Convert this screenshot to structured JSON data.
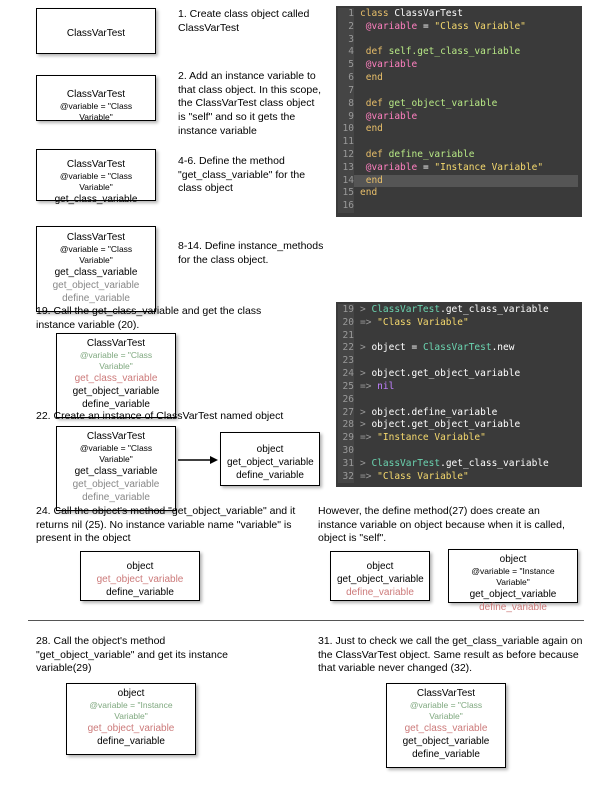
{
  "boxes": {
    "b1": {
      "line1": "ClassVarTest"
    },
    "b2": {
      "line1": "ClassVarTest",
      "line2": "@variable = \"Class Variable\""
    },
    "b3": {
      "line1": "ClassVarTest",
      "line2": "@variable = \"Class Variable\"",
      "line3": "get_class_variable"
    },
    "b4": {
      "line1": "ClassVarTest",
      "line2": "@variable = \"Class Variable\"",
      "line3": "get_class_variable",
      "line4": "get_object_variable",
      "line5": "define_variable"
    },
    "b5": {
      "line1": "ClassVarTest",
      "line2": "@variable = \"Class Variable\"",
      "line3": "get_class_variable",
      "line4": "get_object_variable",
      "line5": "define_variable"
    },
    "b6": {
      "line1": "ClassVarTest",
      "line2": "@variable = \"Class Variable\"",
      "line3": "get_class_variable",
      "line4": "get_object_variable",
      "line5": "define_variable"
    },
    "b6r": {
      "line1": "object",
      "line2": "get_object_variable",
      "line3": "define_variable"
    },
    "b7": {
      "line1": "object",
      "line2": "get_object_variable",
      "line3": "define_variable"
    },
    "b8": {
      "line1": "object",
      "line2": "get_object_variable",
      "line3": "define_variable"
    },
    "b8r": {
      "line1": "object",
      "line2": "@variable = \"Instance Variable\"",
      "line3": "get_object_variable",
      "line4": "define_variable"
    },
    "b9": {
      "line1": "object",
      "line2": "@variable = \"Instance Variable\"",
      "line3": "get_object_variable",
      "line4": "define_variable"
    },
    "b10": {
      "line1": "ClassVarTest",
      "line2": "@variable = \"Class Variable\"",
      "line3": "get_class_variable",
      "line4": "get_object_variable",
      "line5": "define_variable"
    }
  },
  "desc": {
    "d1": "1. Create class object called ClassVarTest",
    "d2": "2. Add an instance variable to that class object. In  this scope, the ClassVarTest class object is \"self\" and so it gets the instance variable",
    "d3": "4-6. Define the method \"get_class_variable\" for the class object",
    "d4": "8-14. Define instance_methods for the class object.",
    "d5": "19. Call the get_class_variable and get the class instance variable (20).",
    "d6": "22. Create an instance of ClassVarTest named object",
    "d7": "24. Call the object's method \"get_object_variable\" and it returns nil (25). No instance variable name \"variable\" is present in the object",
    "d7r": "However, the define method(27) does create an instance variable on object because when it is called, object is \"self\".",
    "d8": "28. Call the object's method \"get_object_variable\" and get its instance variable(29)",
    "d9": "31. Just to check we call the get_class_variable again on the ClassVarTest object. Same result as before because that variable never changed (32)."
  },
  "code1": {
    "l1": {
      "kw": "class",
      "rest": " ClassVarTest"
    },
    "l2": {
      "a": "  ",
      "ivar": "@variable",
      "rest": " = ",
      "str": "\"Class Variable\""
    },
    "l4": {
      "kw": "def",
      "met": " self.get_class_variable"
    },
    "l5": {
      "ivar": "    @variable"
    },
    "l6": {
      "kw": "  end"
    },
    "l8": {
      "kw": "def",
      "met": " get_object_variable"
    },
    "l9": {
      "ivar": "    @variable"
    },
    "l10": {
      "kw": "  end"
    },
    "l12": {
      "kw": "def",
      "met": " define_variable"
    },
    "l13": {
      "a": "    ",
      "ivar": "@variable",
      "rest": " = ",
      "str": "\"Instance Variable\""
    },
    "l14": {
      "kw": "  end"
    },
    "l15": {
      "kw": "end"
    }
  },
  "code2": {
    "l19": {
      "p": ">",
      "a": " ClassVarTest",
      "b": ".get_class_variable"
    },
    "l20": {
      "p": "=>",
      "s": " \"Class Variable\""
    },
    "l22": {
      "p": ">",
      "a": " object = ",
      "b": "ClassVarTest",
      "c": ".new"
    },
    "l24": {
      "p": ">",
      "a": " object.get_object_variable"
    },
    "l25": {
      "p": "=>",
      "n": " nil"
    },
    "l27": {
      "p": ">",
      "a": " object.define_variable"
    },
    "l28": {
      "p": ">",
      "a": " object.get_object_variable"
    },
    "l29": {
      "p": "=>",
      "s": " \"Instance Variable\""
    },
    "l31": {
      "p": ">",
      "a": " ClassVarTest",
      "b": ".get_class_variable"
    },
    "l32": {
      "p": "=>",
      "s": " \"Class Variable\""
    }
  }
}
